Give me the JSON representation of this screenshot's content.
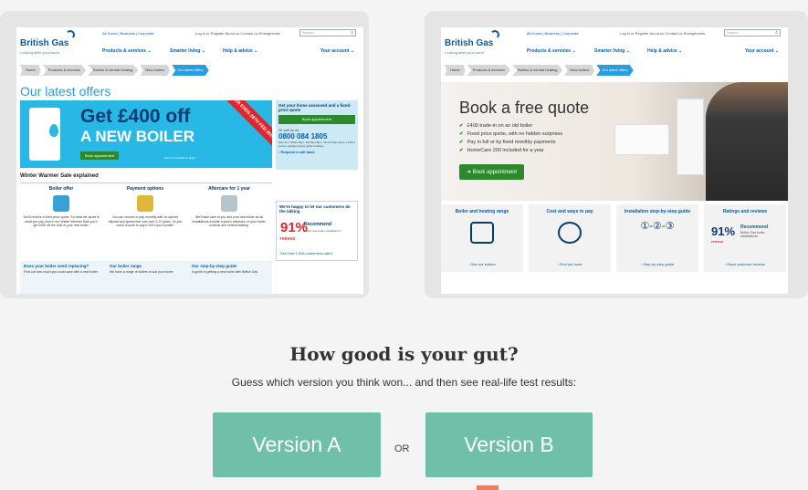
{
  "version_a": {
    "logo": "British Gas",
    "logo_sub": "Looking after your world",
    "top_links": "All Home | Business | Corporate",
    "top_links2": "Log in or Register     About us     Contact us     Emergencies",
    "search_placeholder": "Search",
    "nav": [
      "Products & services ⌄",
      "Smarter living ⌄",
      "Help & advice ⌄"
    ],
    "account": "Your account ⌄",
    "breadcrumbs": [
      "Home",
      "Products & services",
      "Boilers & central heating",
      "New boilers",
      "Our latest offers"
    ],
    "page_title": "Our latest offers",
    "hero_big1": "Get £400 off",
    "hero_big2": "A NEW BOILER",
    "hero_button": "Book appointment",
    "hero_terms": "Terms & Conditions apply",
    "ribbon": "OFFER ENDS 28TH FEB 2015",
    "side_title": "Get your home assessed and a fixed-price quote",
    "side_button": "Book appointment",
    "call_us": "Or call us on",
    "phone": "0800 084 1805",
    "hours": "Mon-Fri 7:30am-8pm, Sat 8am-5pm, Sun 8:30am-5pm. Limited service applies during public holidays.",
    "callback": "› Request a call back",
    "rating_title": "We're happy to let our customers do the talking",
    "rating_pct": "91%",
    "rating_rec": "Recommend",
    "rating_sub": "British Gas boiler installations*",
    "revoo": "reevoo",
    "see_reviews": "See how 1,336 customers rate it",
    "winter_title": "Winter Warmer Sale explained",
    "offers": [
      {
        "title": "Boiler offer",
        "text": "You'll receive a fixed-price quote. So what we quote is what you pay. And in our Winter Warmer Sale you'll get £400 off the cost of your new boiler."
      },
      {
        "title": "Payment options",
        "text": "You can choose to pay monthly with no upfront deposit and spread the cost over 3-10 years. Or you could choose to pay in full if you'd prefer."
      },
      {
        "title": "Aftercare for 1 year",
        "text": "We'll take care of you and your new boiler as all installations include a year's aftercare on your boiler, controls and central heating."
      }
    ],
    "bottom": [
      {
        "title": "Does your boiler need replacing?",
        "text": "Find out how much you could save with a new boiler"
      },
      {
        "title": "Our boiler range",
        "text": "We have a range of boilers to suit your home"
      },
      {
        "title": "Our step-by-step guide",
        "text": "A guide to getting a new boiler with British Gas"
      }
    ]
  },
  "version_b": {
    "logo": "British Gas",
    "logo_sub": "Looking after your world",
    "top_links": "All Home | Business | Corporate",
    "top_links2": "Log in or Register     About us     Contact us     Emergencies",
    "search_placeholder": "Search",
    "nav": [
      "Products & services ⌄",
      "Smarter living ⌄",
      "Help & advice ⌄"
    ],
    "account": "Your account ⌄",
    "breadcrumbs": [
      "Home",
      "Products & services",
      "Boilers & central heating",
      "New boilers",
      "Our latest offers"
    ],
    "hero_title": "Book a free quote",
    "bullets": [
      "£400 trade-in on an old boiler",
      "Fixed price quote, with no hidden surprises",
      "Pay in full or by fixed monthly payments",
      "HomeCare 200 included for a year"
    ],
    "hero_button": "Book appointment",
    "tiles": [
      {
        "title": "Boiler and heating range",
        "link": "› See our boilers"
      },
      {
        "title": "Cost and ways to pay",
        "link": "› Find out more"
      },
      {
        "title": "Installation step-by-step guide",
        "link": "› Step-by-step guide"
      },
      {
        "title": "Ratings and reviews",
        "link": "› Read customer reviews"
      }
    ],
    "tile_steps": "①-②-③",
    "rating_pct": "91%",
    "rating_rec": "Recommend",
    "rating_sub": "British Gas boiler installations*",
    "revoo": "reevoo"
  },
  "question": "How good is your gut?",
  "guess_text": "Guess which version you think won... and then see real-life test results:",
  "version_a_button": "Version A",
  "or_label": "OR",
  "version_b_button": "Version B"
}
